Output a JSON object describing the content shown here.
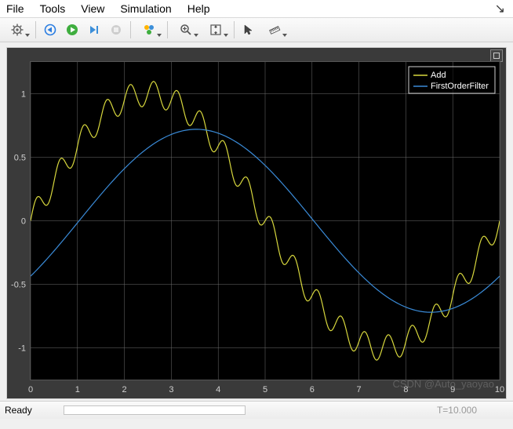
{
  "menu": {
    "file": "File",
    "tools": "Tools",
    "view": "View",
    "simulation": "Simulation",
    "help": "Help"
  },
  "toolbar": {
    "settings_icon": "gear-icon",
    "back_icon": "back-icon",
    "run_icon": "run-icon",
    "step_icon": "step-icon",
    "stop_icon": "stop-icon",
    "highlight_icon": "highlight-icon",
    "zoom_icon": "zoom-icon",
    "scale_icon": "scale-icon",
    "cursor_icon": "cursor-icon",
    "measure_icon": "measure-icon"
  },
  "legend": {
    "series1": "Add",
    "series2": "FirstOrderFilter"
  },
  "colors": {
    "series1": "#d7d73d",
    "series2": "#3a8bd8",
    "grid": "#6e6e6e",
    "axis_text": "#d0d0d0",
    "plot_bg": "#000000",
    "scope_bg": "#3a3a3a"
  },
  "status": {
    "ready": "Ready",
    "time_label": "T=10.000"
  },
  "watermark": "CSDN @Auto_yaoyao",
  "chart_data": {
    "type": "line",
    "xlabel": "",
    "ylabel": "",
    "title": "",
    "x_range": [
      0,
      10
    ],
    "y_range": [
      -1.25,
      1.25
    ],
    "x_ticks": [
      0,
      1,
      2,
      3,
      4,
      5,
      6,
      7,
      8,
      9,
      10
    ],
    "y_ticks": [
      -1,
      -0.5,
      0,
      0.5,
      1
    ],
    "series": [
      {
        "name": "Add",
        "color": "#d7d73d",
        "formula": "sin(2*pi*0.1*t) + 0.1*sin(2*pi*2*t)",
        "base_freq_hz": 0.1,
        "base_amp": 1.0,
        "ripple_freq_hz": 2.0,
        "ripple_amp": 0.1,
        "dt": 0.02
      },
      {
        "name": "FirstOrderFilter",
        "color": "#3a8bd8",
        "formula": "0.72*sin(2*pi*0.1*t - 0.65)",
        "amp": 0.72,
        "freq_hz": 0.1,
        "phase_rad": -0.65,
        "dt": 0.05
      }
    ]
  }
}
